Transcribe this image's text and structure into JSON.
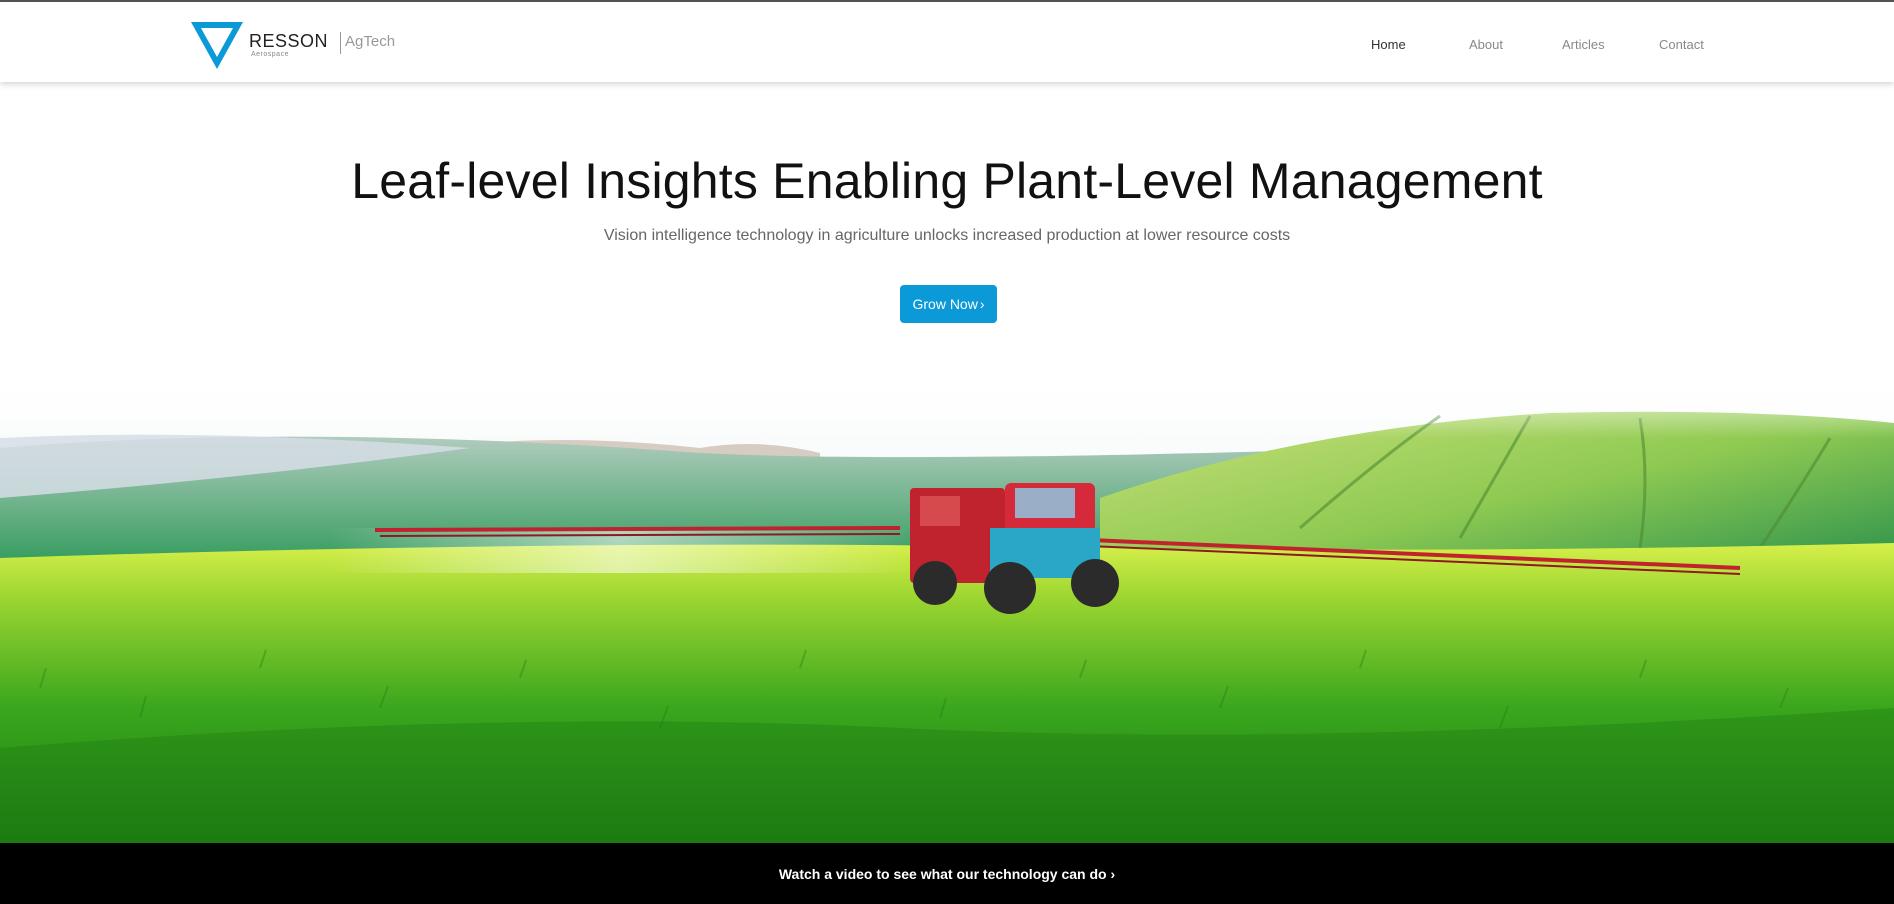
{
  "brand": {
    "name": "RESSON",
    "sub": "Aerospace",
    "tag": "AgTech",
    "accent": "#0b9ad7"
  },
  "nav": {
    "items": [
      {
        "label": "Home",
        "active": true
      },
      {
        "label": "About"
      },
      {
        "label": "Articles"
      },
      {
        "label": "Contact"
      }
    ]
  },
  "hero": {
    "title": "Leaf-level Insights Enabling Plant-Level Management",
    "subtitle": "Vision intelligence technology in agriculture unlocks increased production at lower resource costs",
    "cta_label": "Grow Now",
    "cta_chevron": "›"
  },
  "image": {
    "subject": "tractor-sprayer-in-green-field"
  },
  "footer_bar": {
    "video_link": "Watch a video to see what our technology can do",
    "chevron": "›"
  }
}
